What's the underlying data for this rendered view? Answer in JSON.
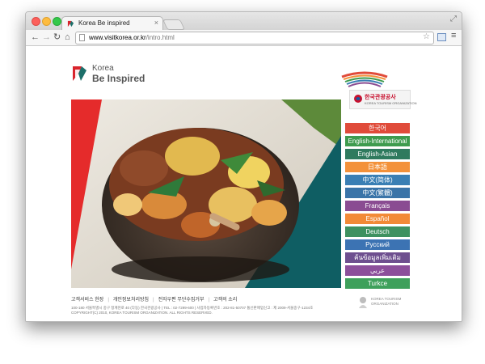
{
  "browser": {
    "tab_title": "Korea Be inspired",
    "tab_close": "×",
    "fullscreen": "⤢",
    "nav_back": "←",
    "nav_forward": "→",
    "nav_reload": "↻",
    "nav_home": "⌂",
    "url_host": "www.visitkorea.or.kr",
    "url_path": "/intro.html",
    "star": "☆",
    "menu": "≡"
  },
  "logo": {
    "korea": "Korea",
    "be_inspired": "Be Inspired"
  },
  "kto": {
    "title": "한국관광공사",
    "subtitle": "KOREA TOURISM ORGANIZATION"
  },
  "languages": [
    {
      "label": "한국어",
      "color": "#e04b3a"
    },
    {
      "label": "English-International",
      "color": "#3e9b4e"
    },
    {
      "label": "English-Asian",
      "color": "#2f7a5e"
    },
    {
      "label": "日本語",
      "color": "#f3913a"
    },
    {
      "label": "中文(简体)",
      "color": "#3a7fb4"
    },
    {
      "label": "中文(繁體)",
      "color": "#3a74a8"
    },
    {
      "label": "Français",
      "color": "#8a4c92"
    },
    {
      "label": "Español",
      "color": "#f28a37"
    },
    {
      "label": "Deutsch",
      "color": "#3e9160"
    },
    {
      "label": "Русский",
      "color": "#3c73b3"
    },
    {
      "label": "ค้นข้อมูลเพิ่มเติม",
      "color": "#6e4f8f"
    },
    {
      "label": "عربي",
      "color": "#8c4f9b"
    },
    {
      "label": "Turkce",
      "color": "#3ea05b"
    }
  ],
  "footer": {
    "links": [
      "고객서비스 헌장",
      "개인정보처리방침",
      "전자우편 무단수집거부",
      "고객의 소리"
    ],
    "separator": "|",
    "address_line1": "100-180 서울특별시 중구 청계천로 40 (다동) 한국관광공사 | TEL : 02-7299-600 | 사업자등록번호 : 202-81-50707 통신판매업신고 : 제 2009-서울중구-1234호",
    "address_line2": "COPYRIGHT(C) 2010, KOREA TOURISM ORGANIZATION. ALL RIGHTS RESERVED.",
    "org_logo_text": "KOREA TOURISM ORGANIZATION"
  }
}
